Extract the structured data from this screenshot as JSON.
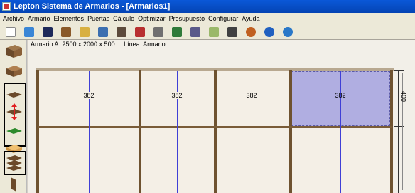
{
  "window": {
    "title": "Lepton Sistema de Armarios - [Armarios1]"
  },
  "menu": [
    "Archivo",
    "Armario",
    "Elementos",
    "Puertas",
    "Cálculo",
    "Optimizar",
    "Presupuesto",
    "Configurar",
    "Ayuda"
  ],
  "toolbar": {
    "buttons": [
      {
        "name": "new-document-icon",
        "color": "#ffffff"
      },
      {
        "name": "open-icon",
        "color": "#3a86d6"
      },
      {
        "name": "save-icon",
        "color": "#1e2a5a"
      },
      {
        "name": "wardrobe-icon",
        "color": "#8a5a2a"
      },
      {
        "name": "pencil-icon",
        "color": "#d8b040"
      },
      {
        "name": "monitor-icon",
        "color": "#3c6fb0"
      },
      {
        "name": "panel-icon",
        "color": "#5c4a3a"
      },
      {
        "name": "book-icon",
        "color": "#b83030"
      },
      {
        "name": "tools-icon",
        "color": "#707070"
      },
      {
        "name": "stack-icon",
        "color": "#2f7a3a"
      },
      {
        "name": "printer-icon",
        "color": "#5a5a8a"
      },
      {
        "name": "list-icon",
        "color": "#9ab86a"
      },
      {
        "name": "draw-icon",
        "color": "#404040"
      },
      {
        "name": "eject-icon",
        "color": "#c06020"
      },
      {
        "name": "cycle-icon",
        "color": "#2060c0"
      },
      {
        "name": "globe-icon",
        "color": "#2a78c8"
      }
    ]
  },
  "canvas": {
    "info_label": "Armario A: 2500 x 2000 x 500",
    "linea_label": "Línea: Armario",
    "dimensions": [
      "382",
      "382",
      "382",
      "382"
    ],
    "side_dimension": "400",
    "selected_color": "#8080d8"
  },
  "lefttools": [
    "wardrobe-top-icon",
    "wardrobe-box-icon",
    "shelf-icon",
    "move-shelf-icon",
    "green-shelf-icon",
    "wood-panel-icon",
    "multiple-shelves-icon",
    "side-panel-icon"
  ]
}
